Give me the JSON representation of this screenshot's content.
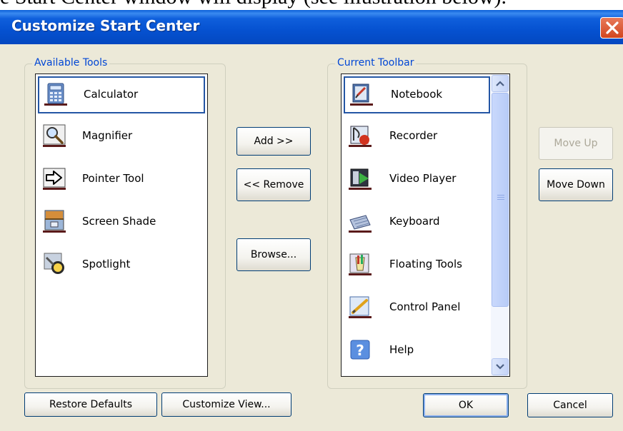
{
  "document": {
    "caption_fragment": "e Start Center window will display (see illustration below)."
  },
  "window": {
    "title": "Customize Start Center"
  },
  "available_tools": {
    "group_label": "Available Tools",
    "items": [
      {
        "label": "Calculator",
        "icon": "calculator-icon",
        "selected": true
      },
      {
        "label": "Magnifier",
        "icon": "magnifier-icon",
        "selected": false
      },
      {
        "label": "Pointer Tool",
        "icon": "pointer-tool-icon",
        "selected": false
      },
      {
        "label": "Screen Shade",
        "icon": "screen-shade-icon",
        "selected": false
      },
      {
        "label": "Spotlight",
        "icon": "spotlight-icon",
        "selected": false
      }
    ]
  },
  "current_toolbar": {
    "group_label": "Current Toolbar",
    "items": [
      {
        "label": "Notebook",
        "icon": "notebook-icon",
        "selected": true
      },
      {
        "label": "Recorder",
        "icon": "recorder-icon",
        "selected": false
      },
      {
        "label": "Video Player",
        "icon": "video-player-icon",
        "selected": false
      },
      {
        "label": "Keyboard",
        "icon": "keyboard-icon",
        "selected": false
      },
      {
        "label": "Floating Tools",
        "icon": "floating-tools-icon",
        "selected": false
      },
      {
        "label": "Control Panel",
        "icon": "control-panel-icon",
        "selected": false
      },
      {
        "label": "Help",
        "icon": "help-icon",
        "selected": false
      }
    ]
  },
  "buttons": {
    "add": "Add >>",
    "remove": "<< Remove",
    "browse": "Browse...",
    "move_up": "Move Up",
    "move_down": "Move Down",
    "restore_defaults": "Restore Defaults",
    "customize_view": "Customize View...",
    "ok": "OK",
    "cancel": "Cancel"
  },
  "colors": {
    "titlebar": "#0551d0",
    "dialog_bg": "#ece9d8",
    "group_label": "#0046d5",
    "selection_border": "#2456a4",
    "close_button": "#d2461f"
  }
}
